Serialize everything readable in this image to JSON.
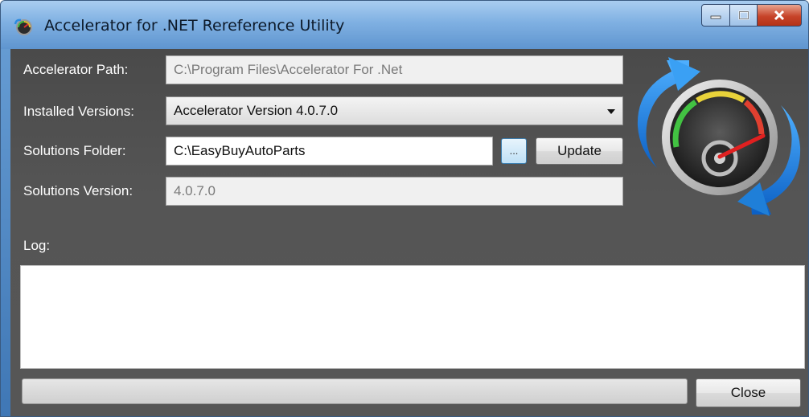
{
  "window": {
    "title": "Accelerator for .NET Rereference Utility"
  },
  "form": {
    "accelerator_path_label": "Accelerator Path:",
    "accelerator_path_value": "C:\\Program Files\\Accelerator For .Net",
    "installed_versions_label": "Installed Versions:",
    "installed_versions_selected": "Accelerator Version 4.0.7.0",
    "solutions_folder_label": "Solutions Folder:",
    "solutions_folder_value": "C:\\EasyBuyAutoParts",
    "browse_label": "...",
    "update_label": "Update",
    "solutions_version_label": "Solutions Version:",
    "solutions_version_value": "4.0.7.0"
  },
  "log": {
    "label": "Log:",
    "content": ""
  },
  "footer": {
    "progress": 0,
    "close_label": "Close"
  },
  "icons": {
    "app": "speedometer-icon",
    "logo": "speedometer-refresh-logo"
  },
  "colors": {
    "content_background": "#565656",
    "titlebar": "#7fb0e2",
    "close_button": "#c7442a"
  }
}
